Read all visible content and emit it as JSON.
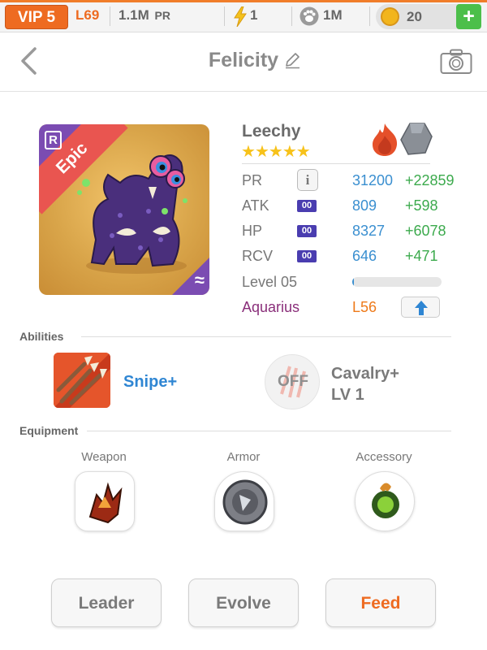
{
  "status_bar": {
    "vip": "VIP 5",
    "level": "L69",
    "power": "1.1M",
    "power_unit": "PR",
    "energy": "1",
    "paw_count": "1M",
    "coins": "20",
    "add_label": "+"
  },
  "header": {
    "title": "Felicity"
  },
  "monster": {
    "name": "Leechy",
    "stars": 5,
    "rarity": "Epic",
    "rank_badge": "R",
    "stats": [
      {
        "label": "PR",
        "value": "31200",
        "bonus": "+22859"
      },
      {
        "label": "ATK",
        "tag": "00",
        "value": "809",
        "bonus": "+598"
      },
      {
        "label": "HP",
        "tag": "00",
        "value": "8327",
        "bonus": "+6078"
      },
      {
        "label": "RCV",
        "tag": "00",
        "value": "646",
        "bonus": "+471"
      }
    ],
    "level_label": "Level 05",
    "level_progress": 0.02,
    "zodiac": "Aquarius",
    "zodiac_level": "L56"
  },
  "abilities": {
    "section_title": "Abilities",
    "items": [
      {
        "name": "Snipe+"
      },
      {
        "name": "Cavalry+",
        "level": "LV 1",
        "status": "OFF"
      }
    ]
  },
  "equipment": {
    "section_title": "Equipment",
    "slots": [
      {
        "label": "Weapon",
        "icon": "weapon-icon"
      },
      {
        "label": "Armor",
        "icon": "armor-icon"
      },
      {
        "label": "Accessory",
        "icon": "accessory-icon"
      }
    ]
  },
  "actions": {
    "leader": "Leader",
    "evolve": "Evolve",
    "feed": "Feed"
  },
  "colors": {
    "accent": "#ee6b21",
    "stat_blue": "#3a8fd0",
    "bonus_green": "#3caa4d",
    "zodiac_purple": "#8a2f7a"
  }
}
